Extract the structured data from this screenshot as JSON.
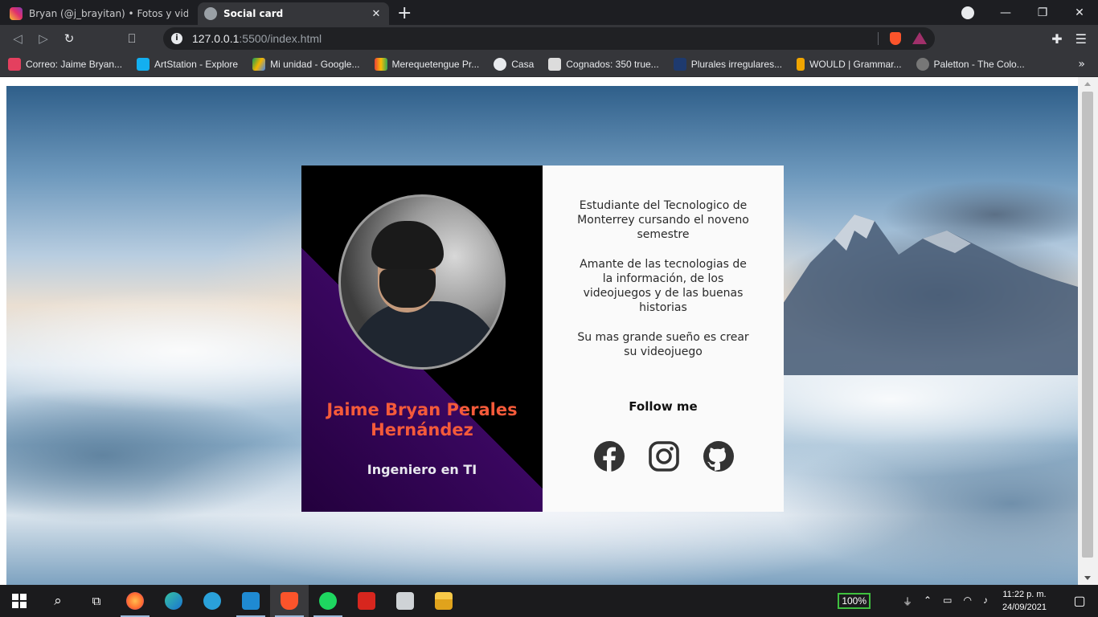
{
  "browser": {
    "tabs": [
      {
        "title": "Bryan (@j_brayitan) • Fotos y videos de Instagram",
        "active": false
      },
      {
        "title": "Social card",
        "active": true
      }
    ],
    "url_host": "127.0.0.1",
    "url_rest": ":5500/index.html",
    "bookmarks": [
      "Correo: Jaime Bryan...",
      "ArtStation - Explore",
      "Mi unidad - Google...",
      "Merequetengue Pr...",
      "Casa",
      "Cognados: 350 true...",
      "Plurales irregulares...",
      "WOULD | Grammar...",
      "Paletton - The Colo..."
    ]
  },
  "card": {
    "name": "Jaime Bryan Perales Hernández",
    "role": "Ingeniero en TI",
    "bio": [
      "Estudiante del Tecnologico de Monterrey cursando el noveno semestre",
      "Amante de las tecnologias de la información, de los videojuegos y de las buenas historias",
      "Su mas grande sueño es crear su videojuego"
    ],
    "follow_title": "Follow me",
    "socials": [
      "facebook-icon",
      "instagram-icon",
      "github-icon"
    ],
    "colors": {
      "name": "#f45a3a",
      "left_dark": "#000000",
      "left_purple": "#3a0760",
      "right_bg": "#fafafa",
      "icon": "#333333"
    }
  },
  "taskbar": {
    "battery": "100%",
    "time": "11:22 p. m.",
    "date": "24/09/2021"
  }
}
